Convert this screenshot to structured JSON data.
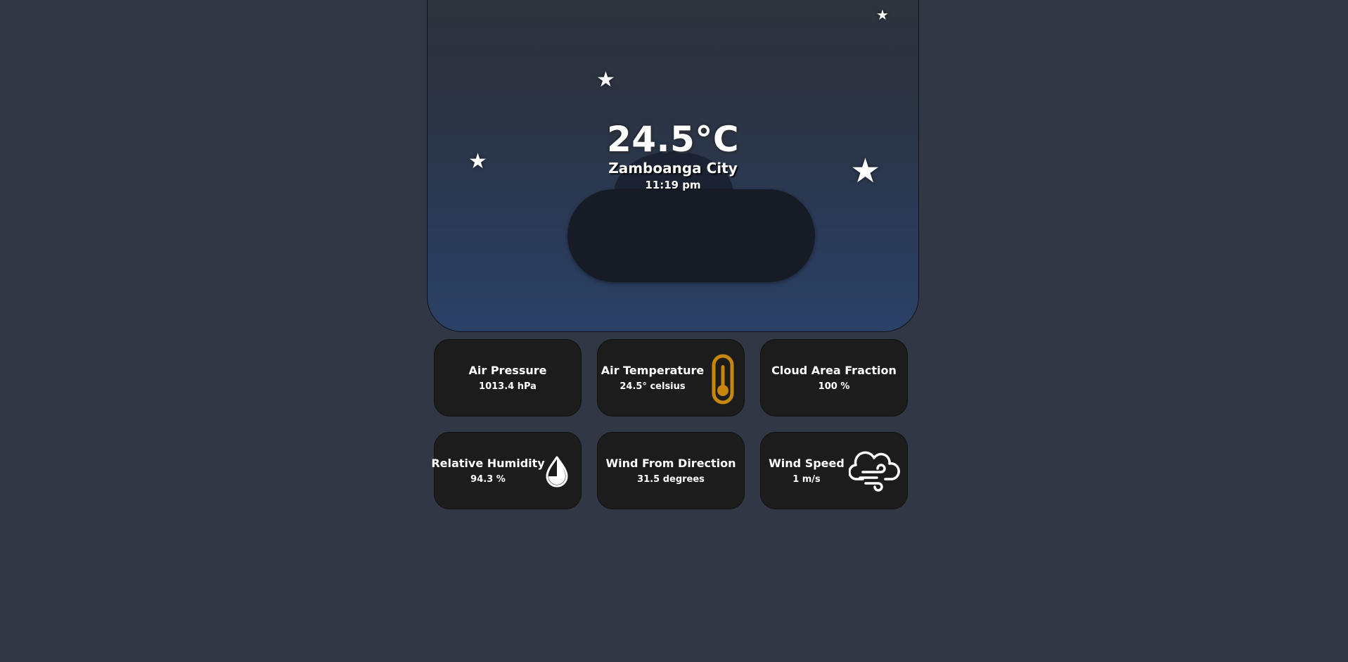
{
  "hero": {
    "temperature": "24.5°C",
    "city": "Zamboanga City",
    "time": "11:19 pm"
  },
  "cards": [
    {
      "title": "Air Pressure",
      "value": "1013.4 hPa",
      "icon": null
    },
    {
      "title": "Air Temperature",
      "value": "24.5° celsius",
      "icon": "thermometer-icon"
    },
    {
      "title": "Cloud Area Fraction",
      "value": "100 %",
      "icon": null
    },
    {
      "title": "Relative Humidity",
      "value": "94.3 %",
      "icon": "water-drop-icon"
    },
    {
      "title": "Wind From Direction",
      "value": "31.5 degrees",
      "icon": null
    },
    {
      "title": "Wind Speed",
      "value": "1 m/s",
      "icon": "windy-cloud-icon"
    }
  ],
  "colors": {
    "page_background": "#313744",
    "card_background": "#1c1c1d",
    "thermometer_accent": "#c7860e",
    "sky_top": "#2e333d",
    "sky_bottom": "#2b4166",
    "cloud": "#161b25"
  }
}
